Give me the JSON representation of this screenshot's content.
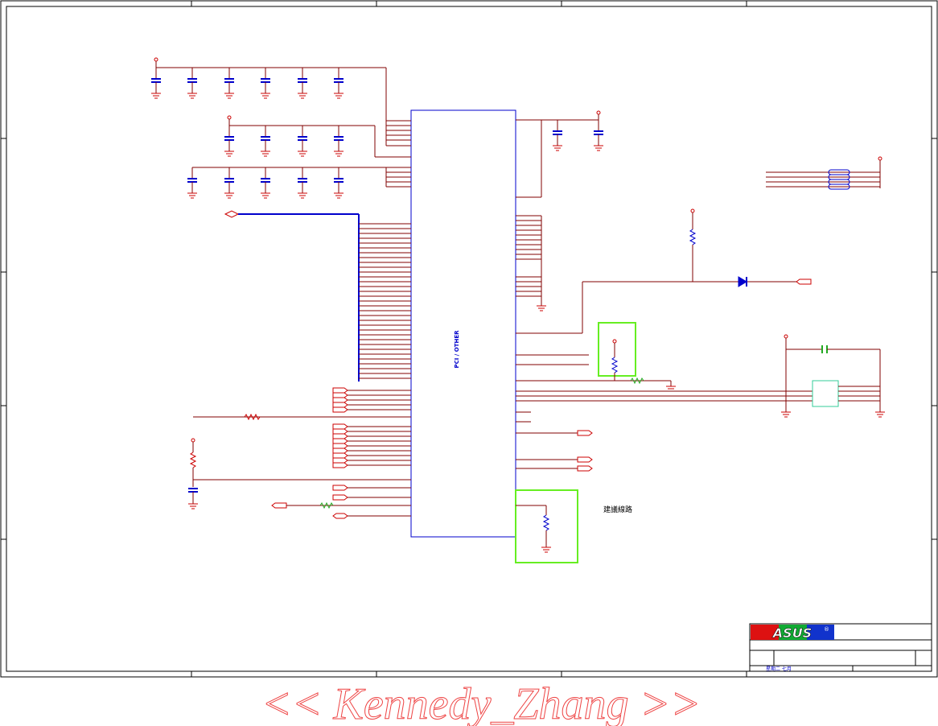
{
  "block": {
    "label": "PCI / OTHER"
  },
  "note": {
    "text": "建議線路"
  },
  "title_block": {
    "logo_text": "ASUS",
    "registered_mark": "®",
    "date_text": "星期二 七月"
  },
  "watermark": {
    "text": "<< Kennedy_Zhang >>"
  },
  "colors": {
    "wire": "#800000",
    "bus": "#0000cc",
    "component": "#cc0000",
    "pin": "#cc00cc",
    "highlight": "#66ee22",
    "capacitor_plate": "#0000cc",
    "teal_box": "#33cc99",
    "frame": "#000000"
  }
}
